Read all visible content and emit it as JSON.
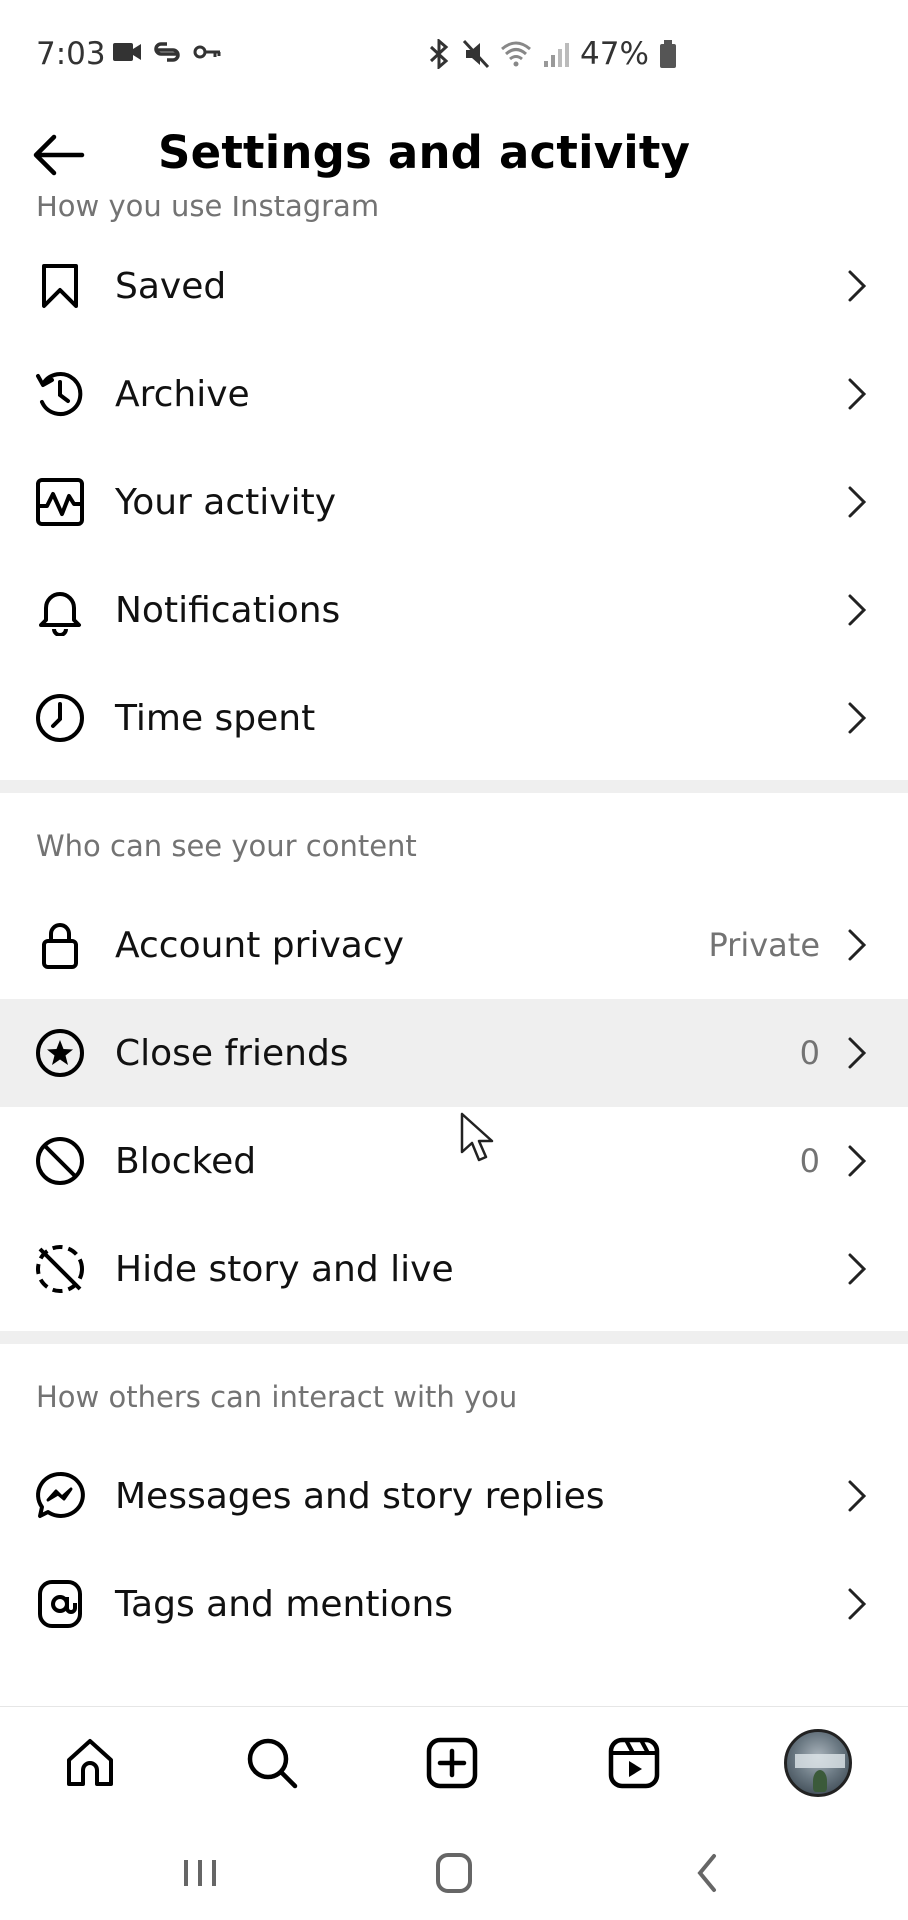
{
  "status_bar": {
    "time": "7:03",
    "battery": "47%"
  },
  "header": {
    "title": "Settings and activity"
  },
  "sections": [
    {
      "title": "How you use Instagram",
      "items": [
        {
          "label": "Saved",
          "icon": "bookmark-icon",
          "value": ""
        },
        {
          "label": "Archive",
          "icon": "archive-history-icon",
          "value": ""
        },
        {
          "label": "Your activity",
          "icon": "activity-icon",
          "value": ""
        },
        {
          "label": "Notifications",
          "icon": "bell-icon",
          "value": ""
        },
        {
          "label": "Time spent",
          "icon": "clock-icon",
          "value": ""
        }
      ]
    },
    {
      "title": "Who can see your content",
      "items": [
        {
          "label": "Account privacy",
          "icon": "lock-icon",
          "value": "Private"
        },
        {
          "label": "Close friends",
          "icon": "star-circle-icon",
          "value": "0"
        },
        {
          "label": "Blocked",
          "icon": "blocked-icon",
          "value": "0"
        },
        {
          "label": "Hide story and live",
          "icon": "hide-story-icon",
          "value": ""
        }
      ]
    },
    {
      "title": "How others can interact with you",
      "items": [
        {
          "label": "Messages and story replies",
          "icon": "messenger-icon",
          "value": ""
        },
        {
          "label": "Tags and mentions",
          "icon": "at-sign-icon",
          "value": ""
        }
      ]
    }
  ],
  "colors": {
    "text_primary": "#111111",
    "text_secondary": "#737373",
    "divider": "#efefef",
    "highlight_row": "#efefef"
  },
  "bottom_nav": [
    {
      "icon": "home-icon"
    },
    {
      "icon": "search-icon"
    },
    {
      "icon": "create-post-icon"
    },
    {
      "icon": "reels-icon"
    },
    {
      "icon": "profile-avatar"
    }
  ],
  "system_nav": [
    {
      "icon": "recent-apps-icon"
    },
    {
      "icon": "home-circle-icon"
    },
    {
      "icon": "system-back-icon"
    }
  ]
}
